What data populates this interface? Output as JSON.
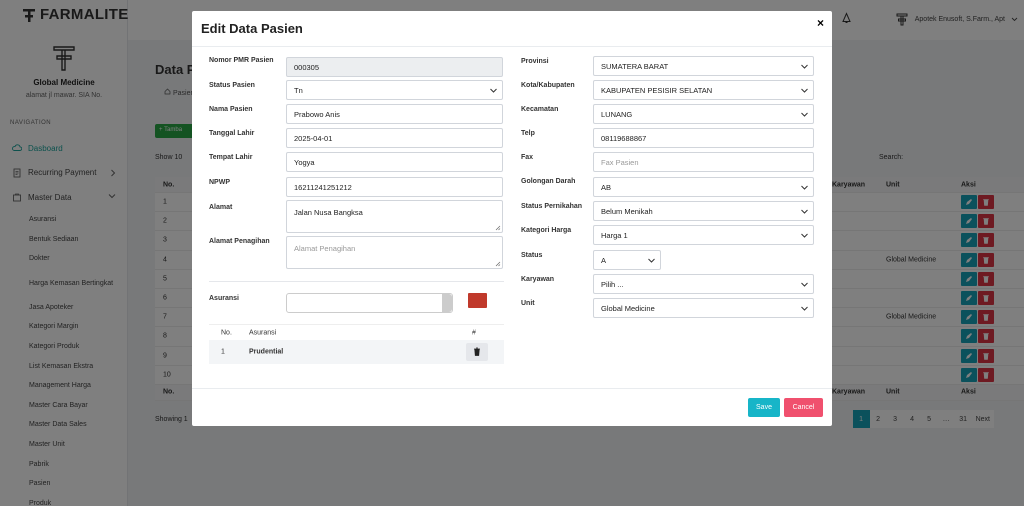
{
  "app": {
    "brand": "FARMALITE"
  },
  "org": {
    "name": "Global Medicine",
    "address": "alamat jl mawar. SIA No."
  },
  "nav": {
    "title": "NAVIGATION",
    "items": [
      {
        "label": "Dasboard",
        "icon": "cloud-icon"
      },
      {
        "label": "Recurring Payment",
        "icon": "document-icon"
      },
      {
        "label": "Master Data",
        "icon": "bag-icon"
      }
    ],
    "sub": [
      "Asuransi",
      "Bentuk Sediaan",
      "Dokter",
      "Harga Kemasan Bertingkat",
      "Jasa Apoteker",
      "Kategori Margin",
      "Kategori Produk",
      "List Kemasan Ekstra",
      "Management Harga",
      "Master Cara Bayar",
      "Master Data Sales",
      "Master Unit",
      "Pabrik",
      "Pasien",
      "Produk"
    ]
  },
  "topbar": {
    "user": "Apotek Enusoft, S.Farm., Apt"
  },
  "page": {
    "title": "Data P",
    "breadcrumb": "Pasien",
    "add_label": "+ Tamba",
    "show_label": "Show 10",
    "search_label": "Search:",
    "showing": "Showing 1",
    "table": {
      "headers": {
        "no": "No.",
        "karyawan": "Karyawan",
        "unit": "Unit",
        "aksi": "Aksi"
      },
      "rows": [
        {
          "no": "1",
          "unit": ""
        },
        {
          "no": "2",
          "unit": ""
        },
        {
          "no": "3",
          "unit": ""
        },
        {
          "no": "4",
          "unit": "Global Medicine"
        },
        {
          "no": "5",
          "unit": ""
        },
        {
          "no": "6",
          "unit": ""
        },
        {
          "no": "7",
          "unit": "Global Medicine"
        },
        {
          "no": "8",
          "unit": ""
        },
        {
          "no": "9",
          "unit": ""
        },
        {
          "no": "10",
          "unit": ""
        }
      ]
    },
    "pagination": [
      "1",
      "2",
      "3",
      "4",
      "5",
      "…",
      "31",
      "Next"
    ]
  },
  "modal": {
    "title": "Edit Data Pasien",
    "close": "×",
    "left": {
      "nomor_pmr": {
        "label": "Nomor PMR Pasien",
        "value": "000305"
      },
      "status": {
        "label": "Status Pasien",
        "value": "Tn"
      },
      "nama": {
        "label": "Nama Pasien",
        "value": "Prabowo Anis"
      },
      "tgl_lahir": {
        "label": "Tanggal Lahir",
        "value": "2025-04-01"
      },
      "tempat_lahir": {
        "label": "Tempat Lahir",
        "value": "Yogya"
      },
      "npwp": {
        "label": "NPWP",
        "value": "16211241251212"
      },
      "alamat": {
        "label": "Alamat",
        "value": "Jalan Nusa Bangksa"
      },
      "alamat_penagihan": {
        "label": "Alamat Penagihan",
        "placeholder": "Alamat Penagihan"
      },
      "asuransi": {
        "label": "Asuransi"
      }
    },
    "asuransi_table": {
      "headers": {
        "no": "No.",
        "asuransi": "Asuransi",
        "hash": "#"
      },
      "rows": [
        {
          "no": "1",
          "name": "Prudential"
        }
      ]
    },
    "right": {
      "provinsi": {
        "label": "Provinsi",
        "value": "SUMATERA BARAT"
      },
      "kota": {
        "label": "Kota/Kabupaten",
        "value": "KABUPATEN PESISIR SELATAN"
      },
      "kecamatan": {
        "label": "Kecamatan",
        "value": "LUNANG"
      },
      "telp": {
        "label": "Telp",
        "value": "08119688867"
      },
      "fax": {
        "label": "Fax",
        "placeholder": "Fax Pasien"
      },
      "gol_darah": {
        "label": "Golongan Darah",
        "value": "AB"
      },
      "pernikahan": {
        "label": "Status Pernikahan",
        "value": "Belum Menikah"
      },
      "kat_harga": {
        "label": "Kategori Harga",
        "value": "Harga 1"
      },
      "status": {
        "label": "Status",
        "value": "A"
      },
      "karyawan": {
        "label": "Karyawan",
        "value": "Pilih ..."
      },
      "unit": {
        "label": "Unit",
        "value": "Global Medicine"
      }
    },
    "save": "Save",
    "cancel": "Cancel"
  }
}
